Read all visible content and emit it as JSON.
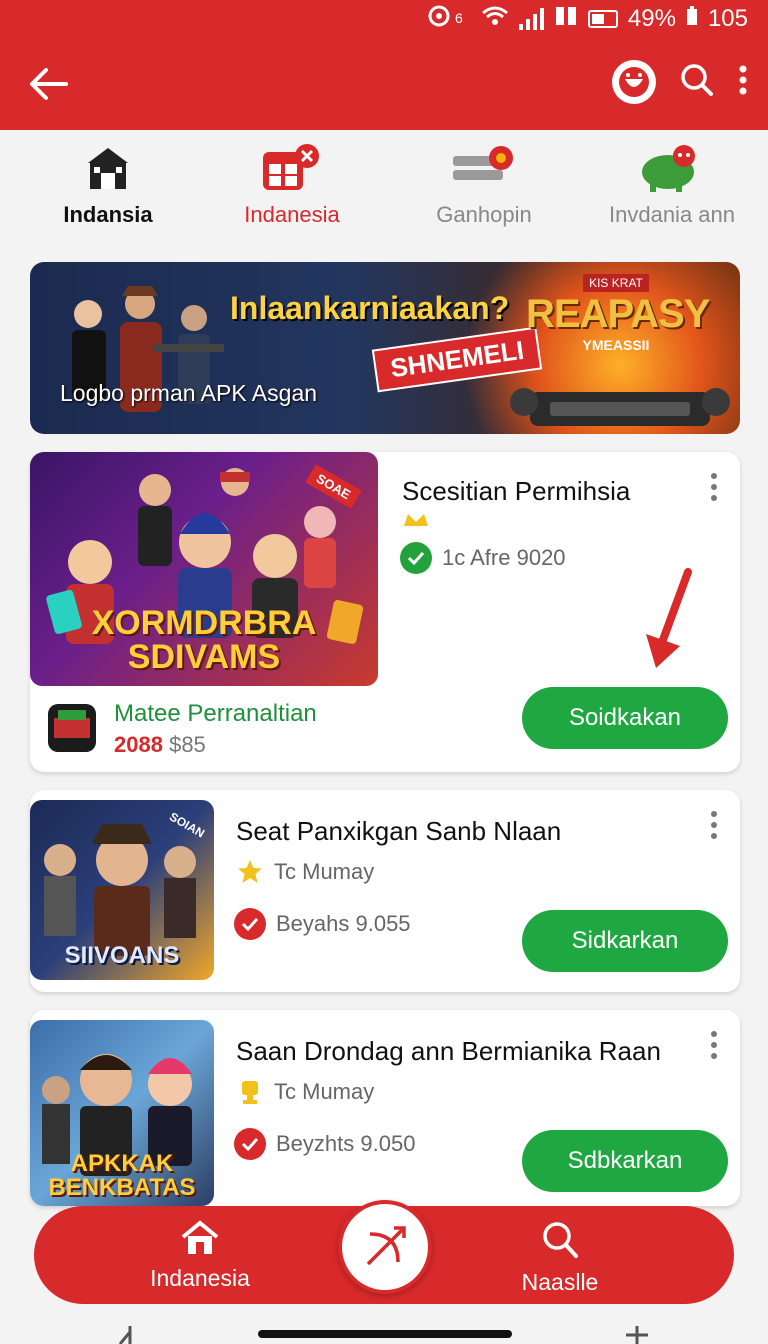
{
  "status_bar": {
    "battery": "49%",
    "extra": "105"
  },
  "categories": [
    {
      "label": "Indansia",
      "color": "#111111"
    },
    {
      "label": "Indanesia",
      "color": "#d8292b"
    },
    {
      "label": "Ganhopin",
      "color": "#888888"
    },
    {
      "label": "Invdania ann",
      "color": "#888888"
    }
  ],
  "banner": {
    "headline": "Inlaankarniaakan?",
    "badge": "SHNEMELI",
    "subtitle": "Logbo prman APK Asgan",
    "brand_small": "KIS KRAT",
    "brand_big": "REAPASY",
    "brand_sub": "YMEASSII"
  },
  "cards": [
    {
      "title": "Scesitian Permihsia",
      "art_text": "XORMDRBRA SDIVAMS",
      "corner_badge": "SOAE",
      "meta": "1c Afre 9020",
      "promo_title": "Matee Perranaltian",
      "price_old": "2088",
      "price_new": "$85",
      "button": "Soidkakan"
    },
    {
      "title": "Seat Panxikgan Sanb Nlaan",
      "art_text": "SIIVOANS",
      "corner_badge": "SOIAN",
      "rating": "Tc Mumay",
      "meta": "Beyahs 9.055",
      "button": "Sidkarkan"
    },
    {
      "title": "Saan Drondag ann Bermianika Raan",
      "art_text": "APKKAK BENKBATAS",
      "rating": "Tc Mumay",
      "meta": "Beyzhts 9.050",
      "button": "Sdbkarkan"
    }
  ],
  "bottom_nav": [
    {
      "label": "Indanesia"
    },
    {
      "label": "Naaslle"
    }
  ],
  "colors": {
    "brand_red": "#d8292b",
    "download_green": "#1fa742",
    "verified_green": "#22a13c"
  }
}
